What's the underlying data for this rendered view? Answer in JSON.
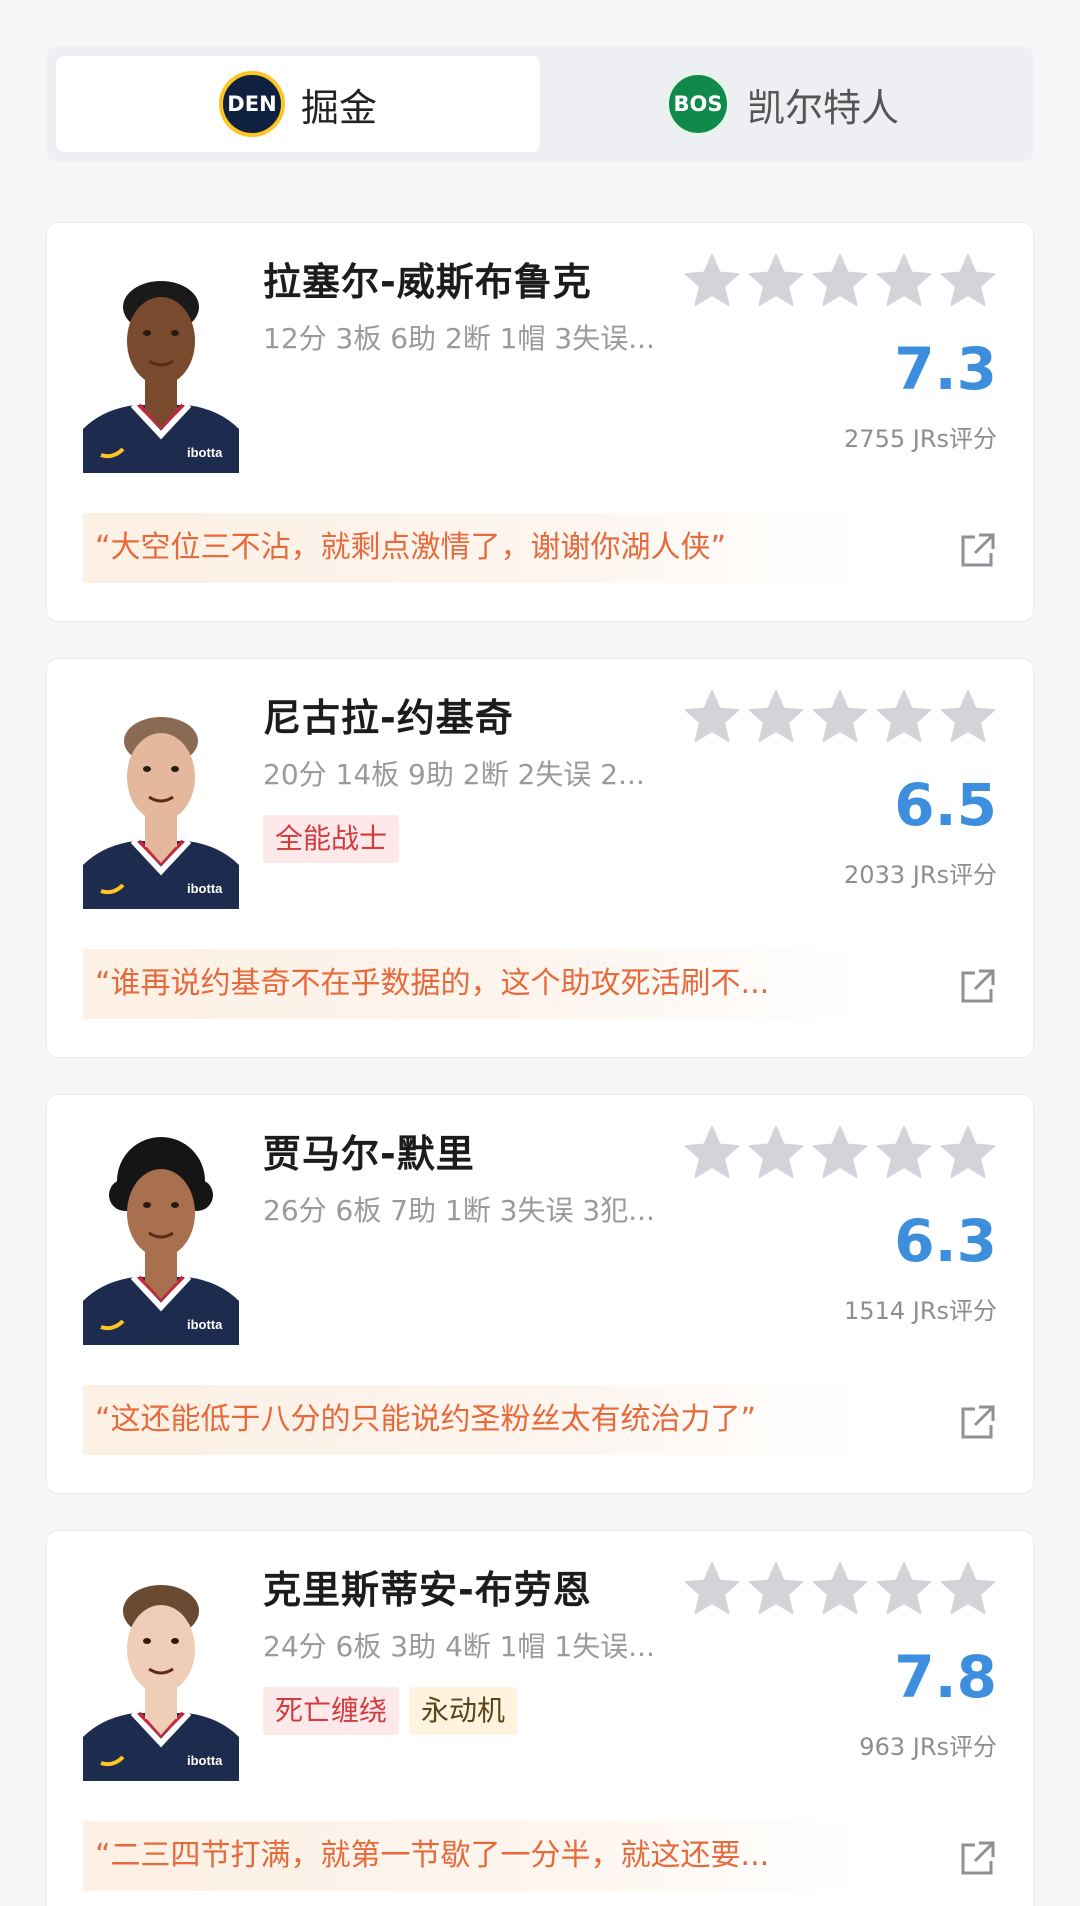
{
  "tabs": [
    {
      "label": "掘金",
      "logo_text": "DEN",
      "active": true
    },
    {
      "label": "凯尔特人",
      "logo_text": "BOS",
      "active": false
    }
  ],
  "players": [
    {
      "name": "拉塞尔-威斯布鲁克",
      "stats": "12分 3板 6助 2断 1帽 3失误...",
      "tags": [],
      "score": "7.3",
      "jrs": "2755 JRs评分",
      "quote": "“大空位三不沾，就剩点激情了，谢谢你湖人侠”",
      "skin": "#7a4a2e",
      "hair": "short-dark"
    },
    {
      "name": "尼古拉-约基奇",
      "stats": "20分 14板 9助 2断 2失误 2...",
      "tags": [
        {
          "text": "全能战士",
          "style": "red"
        }
      ],
      "score": "6.5",
      "jrs": "2033 JRs评分",
      "quote": "“谁再说约基奇不在乎数据的，这个助攻死活刷不...",
      "skin": "#e3b89c",
      "hair": "buzz-brown"
    },
    {
      "name": "贾马尔-默里",
      "stats": "26分 6板 7助 1断 3失误 3犯...",
      "tags": [],
      "score": "6.3",
      "jrs": "1514 JRs评分",
      "quote": "“这还能低于八分的只能说约圣粉丝太有统治力了”",
      "skin": "#a8704e",
      "hair": "curly-black"
    },
    {
      "name": "克里斯蒂安-布劳恩",
      "stats": "24分 6板 3助 4断 1帽 1失误...",
      "tags": [
        {
          "text": "死亡缠绕",
          "style": "red"
        },
        {
          "text": "永动机",
          "style": "gold"
        }
      ],
      "score": "7.8",
      "jrs": "963 JRs评分",
      "quote": "“二三四节打满，就第一节歇了一分半，就这还要...",
      "skin": "#f0cdb6",
      "hair": "short-brown"
    }
  ],
  "jersey_sponsor": "ibotta",
  "icons": {
    "star": "star-icon",
    "share": "share-icon"
  }
}
